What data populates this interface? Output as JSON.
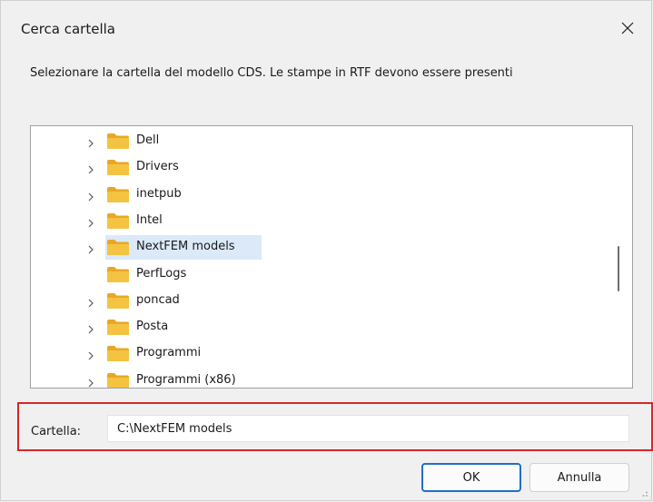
{
  "dialog": {
    "title": "Cerca cartella",
    "instruction": "Selezionare la cartella del modello CDS. Le stampe in RTF devono essere presenti",
    "close_icon": "close-icon"
  },
  "tree": {
    "items": [
      {
        "label": "Dell",
        "has_children": true,
        "selected": false
      },
      {
        "label": "Drivers",
        "has_children": true,
        "selected": false
      },
      {
        "label": "inetpub",
        "has_children": true,
        "selected": false
      },
      {
        "label": "Intel",
        "has_children": true,
        "selected": false
      },
      {
        "label": "NextFEM models",
        "has_children": true,
        "selected": true
      },
      {
        "label": "PerfLogs",
        "has_children": false,
        "selected": false
      },
      {
        "label": "poncad",
        "has_children": true,
        "selected": false
      },
      {
        "label": "Posta",
        "has_children": true,
        "selected": false
      },
      {
        "label": "Programmi",
        "has_children": true,
        "selected": false
      },
      {
        "label": "Programmi (x86)",
        "has_children": true,
        "selected": false
      }
    ],
    "folder_color": "#f5c342",
    "selection_color": "#dbe9f8"
  },
  "path": {
    "label": "Cartella:",
    "value": "C:\\NextFEM models"
  },
  "buttons": {
    "ok_label": "OK",
    "cancel_label": "Annulla"
  },
  "colors": {
    "highlight": "#d6262b",
    "accent": "#1f6fc8"
  }
}
